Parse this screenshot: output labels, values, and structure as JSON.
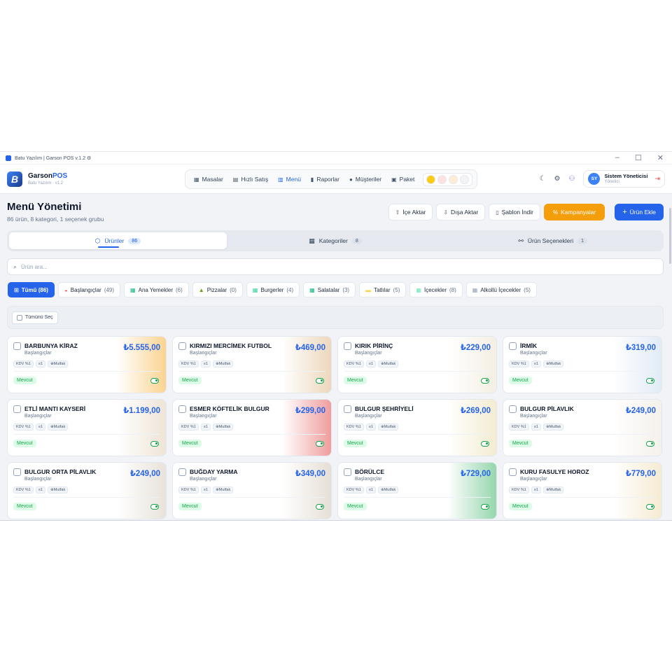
{
  "window": {
    "title": "Batu Yazılım | Garson POS v.1.2 ⚙",
    "controls": [
      "–",
      "☐",
      "✕"
    ]
  },
  "brand": {
    "logo_letter": "B",
    "name_a": "Garson",
    "name_b": "POS",
    "sub": "Batu Yazılım · v1.2"
  },
  "nav": {
    "items": [
      {
        "label": "Masalar",
        "icon": "table-grid-icon",
        "glyph": "▦"
      },
      {
        "label": "Hızlı Satış",
        "icon": "cash-register-icon",
        "glyph": "▤"
      },
      {
        "label": "Menü",
        "icon": "book-icon",
        "glyph": "▥"
      },
      {
        "label": "Raporlar",
        "icon": "bar-chart-icon",
        "glyph": "▮"
      },
      {
        "label": "Müşteriler",
        "icon": "users-icon",
        "glyph": "●"
      },
      {
        "label": "Paket",
        "icon": "package-icon",
        "glyph": "▣"
      }
    ],
    "active_index": 2
  },
  "header_icons": {
    "theme": "☾",
    "settings": "⚙",
    "users": "⚇"
  },
  "user": {
    "initials": "SY",
    "name": "Sistem Yöneticisi",
    "role": "Yönetici",
    "logout": "⇥"
  },
  "page": {
    "title": "Menü Yönetimi",
    "subtitle": "86 ürün, 8 kategori, 1 seçenek grubu"
  },
  "actions": {
    "import": "İçe Aktar",
    "export": "Dışa Aktar",
    "template": "Şablon İndir",
    "campaigns": "Kampanyalar",
    "add": "Ürün Ekle"
  },
  "tabs": [
    {
      "label": "Ürünler",
      "count": "86",
      "glyph": "⬡"
    },
    {
      "label": "Kategoriler",
      "count": "8",
      "glyph": "▦"
    },
    {
      "label": "Ürün Seçenekleri",
      "count": "1",
      "glyph": "⚯"
    }
  ],
  "search": {
    "placeholder": "Ürün ara..."
  },
  "chips": [
    {
      "label": "Tümü (86)",
      "count": "",
      "glyph": "⊞",
      "color": "#ffffff"
    },
    {
      "label": "Başlangıçlar",
      "count": "(49)",
      "glyph": "◒",
      "color": "#ef4444"
    },
    {
      "label": "Ana Yemekler",
      "count": "(6)",
      "glyph": "▦",
      "color": "#10b981"
    },
    {
      "label": "Pizzalar",
      "count": "(0)",
      "glyph": "▲",
      "color": "#65a30d"
    },
    {
      "label": "Burgerler",
      "count": "(4)",
      "glyph": "▦",
      "color": "#34d399"
    },
    {
      "label": "Salatalar",
      "count": "(3)",
      "glyph": "▦",
      "color": "#10b981"
    },
    {
      "label": "Tatlılar",
      "count": "(5)",
      "glyph": "▬",
      "color": "#fcd34d"
    },
    {
      "label": "İçecekler",
      "count": "(8)",
      "glyph": "▦",
      "color": "#6ee7b7"
    },
    {
      "label": "Alkollü İçecekler",
      "count": "(5)",
      "glyph": "▦",
      "color": "#94a3b8"
    }
  ],
  "select_all": "Tümünü Seç",
  "tags": {
    "kdv": "KDV %1",
    "qty": "≡1",
    "kitchen": "⊕Mutfak"
  },
  "status_label": "Mevcut",
  "products": [
    {
      "name": "BARBUNYA KİRAZ",
      "category": "Başlangıçlar",
      "price": "₺5.555,00",
      "thumb": "#f59e0b"
    },
    {
      "name": "KIRMIZI MERCİMEK FUTBOL",
      "category": "Başlangıçlar",
      "price": "₺469,00",
      "thumb": "#d6a76b"
    },
    {
      "name": "KIRIK PİRİNÇ",
      "category": "Başlangıçlar",
      "price": "₺229,00",
      "thumb": "#e7dcc3"
    },
    {
      "name": "İRMİK",
      "category": "Başlangıçlar",
      "price": "₺319,00",
      "thumb": "#bcd3ea"
    },
    {
      "name": "ETLİ MANTI KAYSERİ",
      "category": "Başlangıçlar",
      "price": "₺1.199,00",
      "thumb": "#d9c3a5"
    },
    {
      "name": "ESMER KÖFTELİK BULGUR",
      "category": "Başlangıçlar",
      "price": "₺299,00",
      "thumb": "#dc2626"
    },
    {
      "name": "BULGUR ŞEHRİYELİ",
      "category": "Başlangıçlar",
      "price": "₺269,00",
      "thumb": "#e5d49a"
    },
    {
      "name": "BULGUR PİLAVLIK",
      "category": "Başlangıçlar",
      "price": "₺249,00",
      "thumb": "#e8dfd2"
    },
    {
      "name": "BULGUR ORTA PİLAVLIK",
      "category": "Başlangıçlar",
      "price": "₺249,00",
      "thumb": "#cbbfae"
    },
    {
      "name": "BUĞDAY YARMA",
      "category": "Başlangıçlar",
      "price": "₺349,00",
      "thumb": "#c8b8a4"
    },
    {
      "name": "BÖRÜLCE",
      "category": "Başlangıçlar",
      "price": "₺729,00",
      "thumb": "#16a34a"
    },
    {
      "name": "KURU FASULYE HOROZ",
      "category": "Başlangıçlar",
      "price": "₺779,00",
      "thumb": "#e9d39a"
    }
  ]
}
